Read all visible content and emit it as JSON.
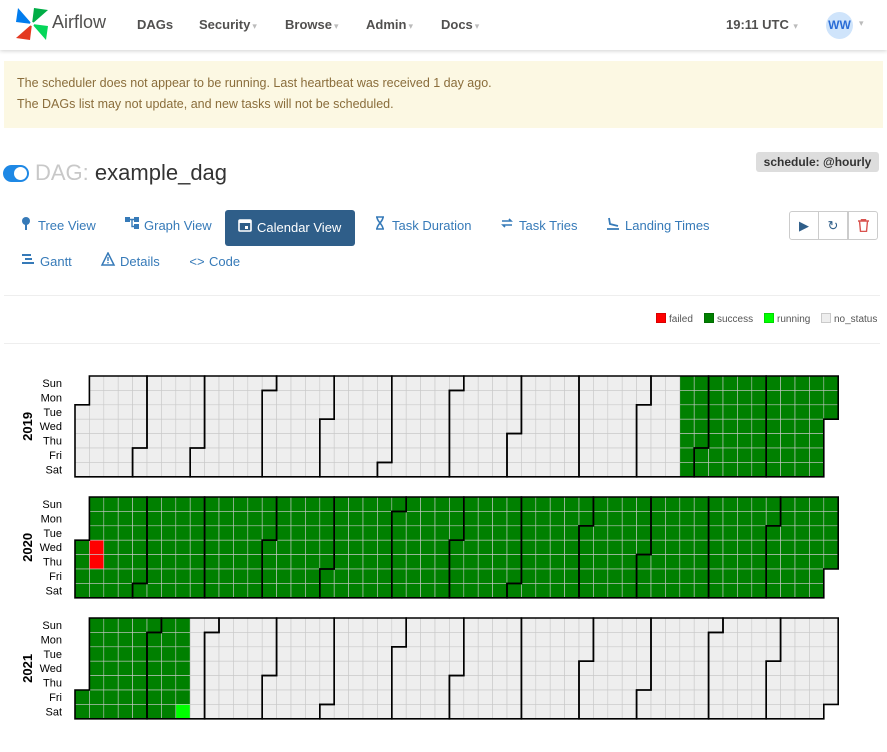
{
  "navbar": {
    "brand": "Airflow",
    "items": [
      "DAGs",
      "Security",
      "Browse",
      "Admin",
      "Docs"
    ],
    "time": "19:11 UTC",
    "user_initials": "WW"
  },
  "alert": {
    "line1": "The scheduler does not appear to be running. Last heartbeat was received 1 day ago.",
    "line2": "The DAGs list may not update, and new tasks will not be scheduled."
  },
  "dag": {
    "prefix": "DAG:",
    "name": "example_dag",
    "schedule": "schedule: @hourly",
    "paused": false
  },
  "tabs": [
    {
      "label": "Tree View",
      "icon": "tree-icon"
    },
    {
      "label": "Graph View",
      "icon": "graph-icon"
    },
    {
      "label": "Calendar View",
      "icon": "calendar-icon",
      "active": true
    },
    {
      "label": "Task Duration",
      "icon": "hourglass-icon"
    },
    {
      "label": "Task Tries",
      "icon": "retry-icon"
    },
    {
      "label": "Landing Times",
      "icon": "landing-icon"
    },
    {
      "label": "Gantt",
      "icon": "gantt-icon"
    },
    {
      "label": "Details",
      "icon": "warning-icon"
    },
    {
      "label": "Code",
      "icon": "code-icon"
    }
  ],
  "actions": [
    {
      "name": "trigger-dag",
      "icon": "play-icon"
    },
    {
      "name": "refresh",
      "icon": "refresh-icon"
    },
    {
      "name": "delete-dag",
      "icon": "trash-icon"
    }
  ],
  "legend": [
    {
      "label": "failed",
      "color": "#ff0000"
    },
    {
      "label": "success",
      "color": "#008000"
    },
    {
      "label": "running",
      "color": "#00ff00"
    },
    {
      "label": "no_status",
      "color": "#eeeeee"
    }
  ],
  "calendar": {
    "weekdays": [
      "Sun",
      "Mon",
      "Tue",
      "Wed",
      "Thu",
      "Fri",
      "Sat"
    ],
    "years": [
      "2019",
      "2020",
      "2021"
    ],
    "success_range": [
      "2019-10-20",
      "2021-02-19"
    ],
    "failed_days": [
      "2020-01-08",
      "2020-01-09"
    ],
    "running_days": [
      "2021-02-20"
    ],
    "colors": {
      "failed": "#ff0000",
      "success": "#008000",
      "running": "#00ff00",
      "no_status": "#eeeeee"
    }
  }
}
